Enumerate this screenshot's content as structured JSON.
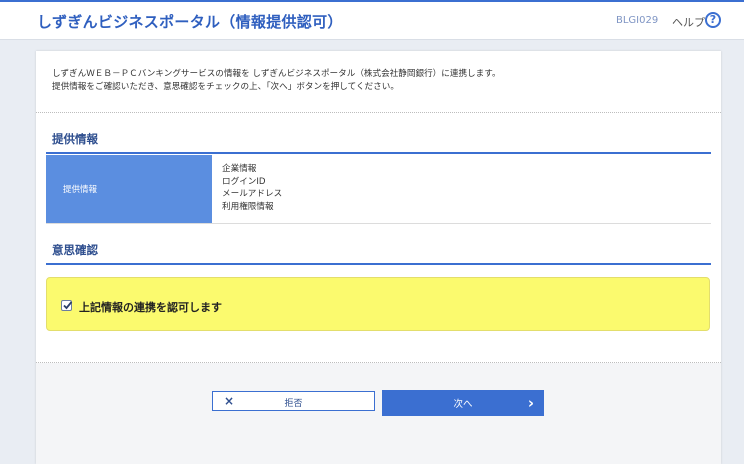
{
  "header": {
    "title": "しずぎんビジネスポータル（情報提供認可）",
    "screen_id": "BLGI029",
    "help_label": "ヘルプ",
    "help_icon": "?"
  },
  "intro": {
    "line1": "しずぎんＷＥＢ－ＰＣバンキングサービスの情報を しずぎんビジネスポータル（株式会社静岡銀行）に連携します。",
    "line2": "提供情報をご確認いただき、意思確認をチェックの上、「次へ」ボタンを押してください。"
  },
  "provided_section": {
    "heading": "提供情報",
    "row_label": "提供情報",
    "items": [
      "企業情報",
      "ログインID",
      "メールアドレス",
      "利用権限情報"
    ]
  },
  "consent_section": {
    "heading": "意思確認",
    "checkbox_label": "上記情報の連携を認可します",
    "checked": true
  },
  "buttons": {
    "reject_label": "拒否",
    "reject_icon": "×",
    "next_label": "次へ",
    "next_icon": "›"
  },
  "colors": {
    "accent": "#3b6fd1",
    "table_header": "#5b8ee0",
    "consent_background": "#fbfa6e"
  }
}
